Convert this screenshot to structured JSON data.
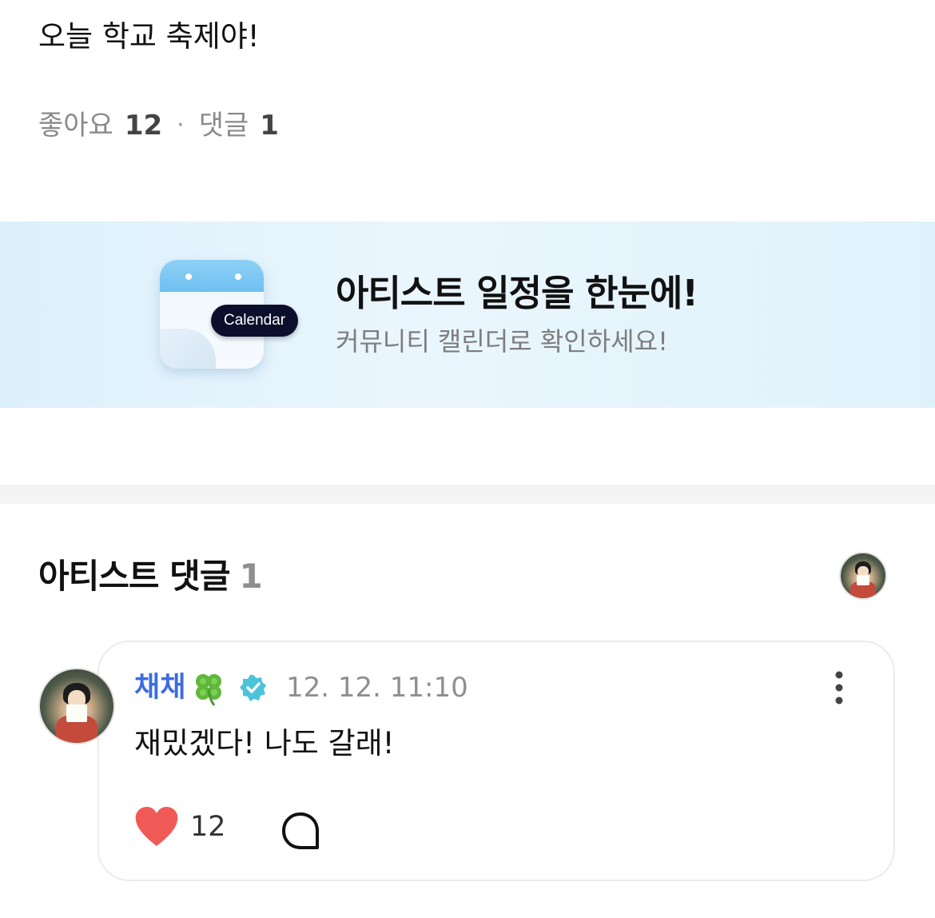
{
  "post": {
    "text": "오늘 학교 축제야!",
    "likes_label": "좋아요",
    "likes_count": "12",
    "separator": "·",
    "comments_label": "댓글",
    "comments_count": "1"
  },
  "banner": {
    "icon_label": "Calendar",
    "title": "아티스트 일정을 한눈에!",
    "subtitle": "커뮤니티 캘린더로 확인하세요!"
  },
  "artist_comments": {
    "title": "아티스트 댓글",
    "count": "1"
  },
  "comment": {
    "author": "채채",
    "author_emoji": "four-leaf-clover-icon",
    "verified": "verified-badge-icon",
    "date": "12. 12. 11:10",
    "text": "재밌겠다! 나도 갈래!",
    "likes": "12"
  },
  "colors": {
    "author": "#3c6ce0",
    "heart": "#f05a56",
    "verified": "#4cc3d9",
    "banner_bg": "#e3f3fc"
  }
}
